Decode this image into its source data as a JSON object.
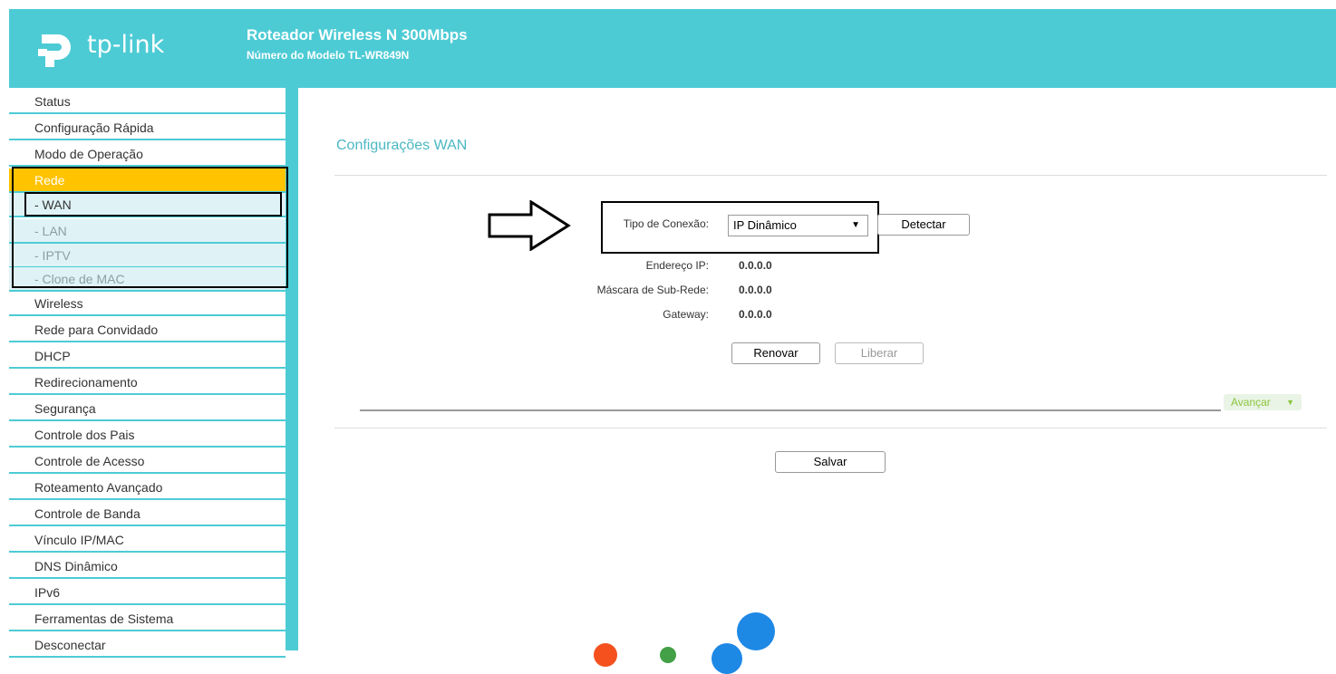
{
  "header": {
    "logo_text": "tp-link",
    "product_title": "Roteador Wireless N 300Mbps",
    "model_line": "Número do Modelo TL-WR849N"
  },
  "sidebar": {
    "items": [
      {
        "label": "Status"
      },
      {
        "label": "Configuração Rápida"
      },
      {
        "label": "Modo de Operação"
      },
      {
        "label": "Rede"
      },
      {
        "label": "- WAN"
      },
      {
        "label": "- LAN"
      },
      {
        "label": "- IPTV"
      },
      {
        "label": "- Clone de MAC"
      },
      {
        "label": "Wireless"
      },
      {
        "label": "Rede para Convidado"
      },
      {
        "label": "DHCP"
      },
      {
        "label": "Redirecionamento"
      },
      {
        "label": "Segurança"
      },
      {
        "label": "Controle dos Pais"
      },
      {
        "label": "Controle de Acesso"
      },
      {
        "label": "Roteamento Avançado"
      },
      {
        "label": "Controle de Banda"
      },
      {
        "label": "Vínculo IP/MAC"
      },
      {
        "label": "DNS Dinâmico"
      },
      {
        "label": "IPv6"
      },
      {
        "label": "Ferramentas de Sistema"
      },
      {
        "label": "Desconectar"
      }
    ]
  },
  "main": {
    "title": "Configurações WAN",
    "connection_type_label": "Tipo de Conexão:",
    "connection_type_value": "IP Dinâmico",
    "detect_button": "Detectar",
    "ip_label": "Endereço IP:",
    "ip_value": "0.0.0.0",
    "mask_label": "Máscara de Sub-Rede:",
    "mask_value": "0.0.0.0",
    "gateway_label": "Gateway:",
    "gateway_value": "0.0.0.0",
    "renew_button": "Renovar",
    "release_button": "Liberar",
    "advanced_button": "Avançar",
    "save_button": "Salvar"
  },
  "colors": {
    "header_bg": "#4dcbd5",
    "active_menu": "#ffc300",
    "title_color": "#4bb8c3"
  }
}
